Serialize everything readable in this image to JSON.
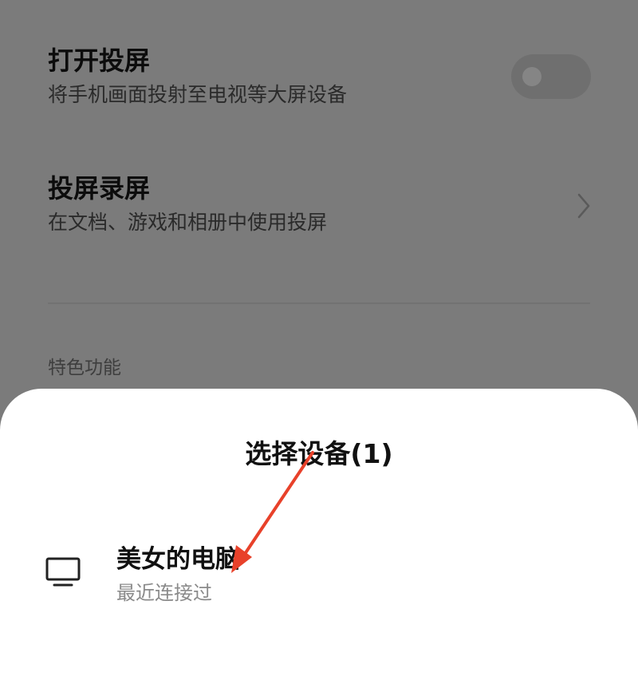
{
  "settings": {
    "cast": {
      "title": "打开投屏",
      "subtitle": "将手机画面投射至电视等大屏设备",
      "toggle_on": false
    },
    "mirror": {
      "title": "投屏录屏",
      "subtitle": "在文档、游戏和相册中使用投屏"
    },
    "section_label": "特色功能"
  },
  "sheet": {
    "title": "选择设备(1)",
    "devices": [
      {
        "icon": "monitor-icon",
        "name": "美女的电脑",
        "status": "最近连接过"
      }
    ]
  },
  "annotation": {
    "color": "#e8412a",
    "icon": "red-arrow"
  }
}
